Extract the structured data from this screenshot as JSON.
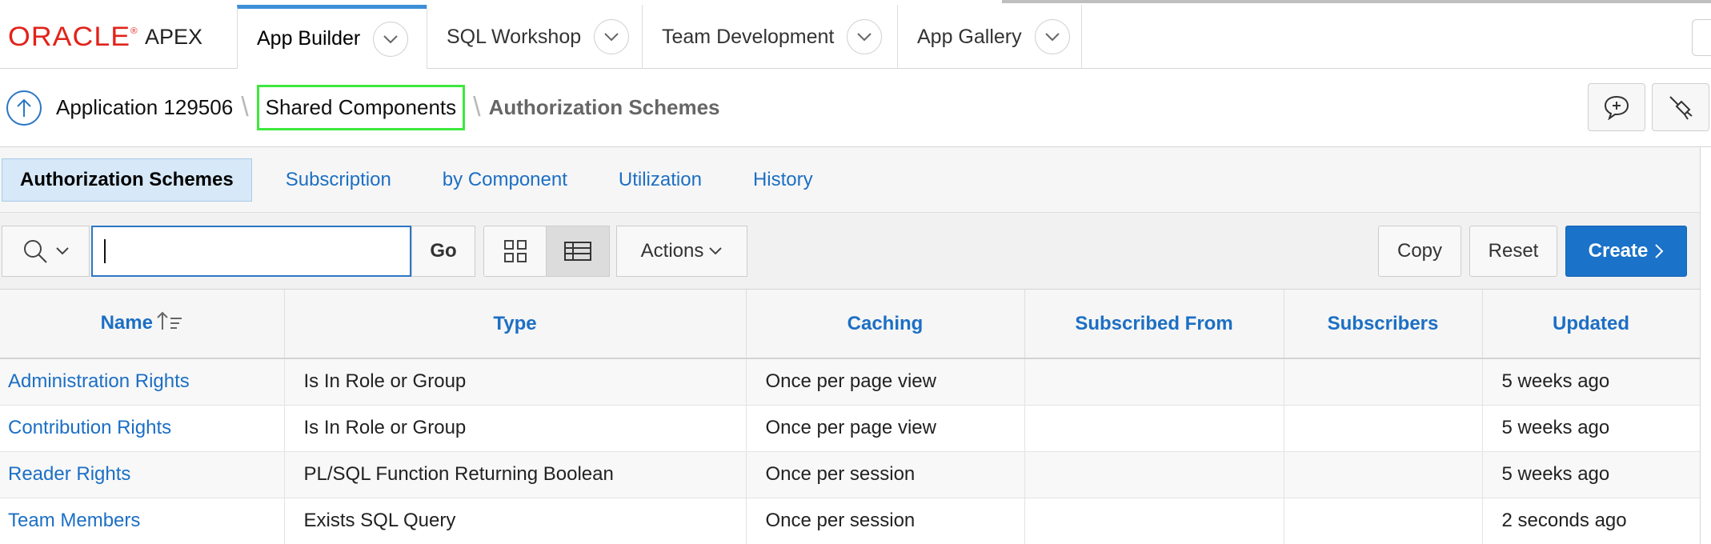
{
  "header": {
    "logo_oracle": "ORACLE",
    "logo_apex": "APEX",
    "tabs": [
      {
        "label": "App Builder"
      },
      {
        "label": "SQL Workshop"
      },
      {
        "label": "Team Development"
      },
      {
        "label": "App Gallery"
      }
    ]
  },
  "breadcrumb": {
    "items": [
      {
        "label": "Application 129506"
      },
      {
        "label": "Shared Components"
      },
      {
        "label": "Authorization Schemes"
      }
    ]
  },
  "subtabs": [
    {
      "label": "Authorization Schemes"
    },
    {
      "label": "Subscription"
    },
    {
      "label": "by Component"
    },
    {
      "label": "Utilization"
    },
    {
      "label": "History"
    }
  ],
  "toolbar": {
    "search_value": "",
    "go_label": "Go",
    "actions_label": "Actions",
    "copy_label": "Copy",
    "reset_label": "Reset",
    "create_label": "Create"
  },
  "table": {
    "columns": [
      "Name",
      "Type",
      "Caching",
      "Subscribed From",
      "Subscribers",
      "Updated"
    ],
    "rows": [
      {
        "name": "Administration Rights",
        "type": "Is In Role or Group",
        "caching": "Once per page view",
        "subscribed_from": "",
        "subscribers": "",
        "updated": "5 weeks ago"
      },
      {
        "name": "Contribution Rights",
        "type": "Is In Role or Group",
        "caching": "Once per page view",
        "subscribed_from": "",
        "subscribers": "",
        "updated": "5 weeks ago"
      },
      {
        "name": "Reader Rights",
        "type": "PL/SQL Function Returning Boolean",
        "caching": "Once per session",
        "subscribed_from": "",
        "subscribers": "",
        "updated": "5 weeks ago"
      },
      {
        "name": "Team Members",
        "type": "Exists SQL Query",
        "caching": "Once per session",
        "subscribed_from": "",
        "subscribers": "",
        "updated": "2 seconds ago"
      }
    ]
  },
  "colors": {
    "oracle_red": "#e2231a",
    "link_blue": "#1c6fc4",
    "create_blue": "#1a72c9",
    "highlight_green": "#3ee83e",
    "active_tab_bg": "#d7e8f8"
  }
}
